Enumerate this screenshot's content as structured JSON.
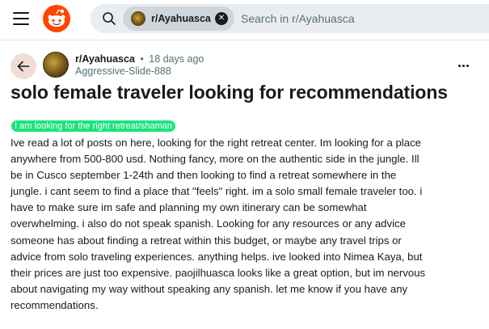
{
  "header": {
    "search_chip_label": "r/Ayahuasca",
    "search_placeholder": "Search in r/Ayahuasca"
  },
  "post": {
    "subreddit": "r/Ayahuasca",
    "separator": "•",
    "time_ago": "18 days ago",
    "author": "Aggressive-Slide-888",
    "title": "solo female traveler looking for recommendations",
    "flair": "I am looking for the right retreat/shaman",
    "body_lines": [
      "Ive read a lot of posts on here, looking for the right retreat center. Im looking for a place",
      "anywhere from 500-800 usd. Nothing fancy, more on the authentic side in the jungle. Ill",
      "be in Cusco september 1-24th and then looking to find a retreat somewhere in the",
      "jungle. i cant seem to find a place that \"feels\" right. im a solo small female traveler too. i",
      "have to make sure im safe and planning my own itinerary can be somewhat",
      "overwhelming. i also do not speak spanish. Looking for any resources or any advice",
      "someone has about finding a retreat within this budget, or maybe any travel trips or",
      "advice from solo traveling experiences. anything helps. ive looked into Nimea Kaya, but",
      "their prices are just too expensive. paojilhuasca looks like a great option, but im nervous",
      "about navigating my way without speaking any spanish. let me know if you have any",
      "recommendations."
    ]
  },
  "colors": {
    "flair_bg": "#1ae47c",
    "back_button_bg": "#f2dcd6",
    "logo_orange": "#ff4500",
    "search_bg": "#eaedef"
  },
  "icons": [
    "menu-icon",
    "reddit-logo-icon",
    "search-icon",
    "clear-icon",
    "back-arrow-icon",
    "more-options-icon"
  ]
}
